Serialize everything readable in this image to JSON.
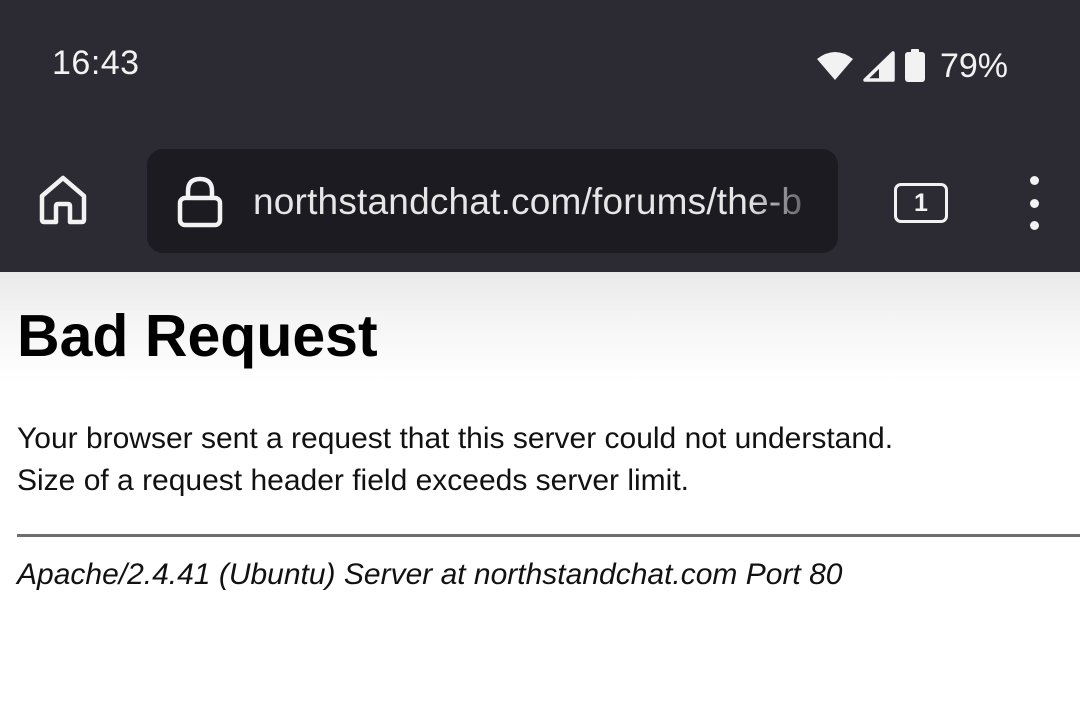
{
  "status_bar": {
    "time": "16:43",
    "battery_percent": "79%",
    "icons": [
      "wifi-icon",
      "cell-signal-icon",
      "battery-icon"
    ]
  },
  "toolbar": {
    "url": "northstandchat.com/forums/the-b",
    "tab_count": "1",
    "icons": [
      "home-icon",
      "lock-icon",
      "tab-switcher-icon",
      "more-menu-icon"
    ]
  },
  "page": {
    "title": "Bad Request",
    "message_line1": "Your browser sent a request that this server could not understand.",
    "message_line2": "Size of a request header field exceeds server limit.",
    "server_signature": "Apache/2.4.41 (Ubuntu) Server at northstandchat.com Port 80"
  },
  "colors": {
    "chrome_bg": "#2c2b33",
    "url_bar_bg": "#1c1b21",
    "chrome_text": "#f2f2f2",
    "page_bg": "#ffffff"
  }
}
